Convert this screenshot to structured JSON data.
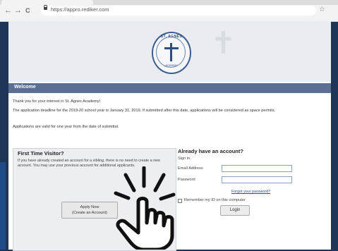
{
  "browser": {
    "url": "https://appro.rediker.com",
    "back_icon": "←",
    "forward_icon": "→",
    "reload_icon": "C",
    "star_icon": "☆"
  },
  "seal": {
    "top_text": "ST. AGNES",
    "bottom_text": "ACADEMY"
  },
  "welcome": {
    "title": "Welcome",
    "line1": "Thank you for your interest in St. Agnes Academy!",
    "line2": "The application deadline for the 2019-20 school year is January 31, 2019. If submitted after this date, applications will be considered as space permits.",
    "line3": "Applications are valid for one year from the date of submittal."
  },
  "first_time": {
    "title": "First Time Visitor?",
    "description": "If you have already created an account for a sibling, there is no need to create a new account. You may use your previous account for additional applicants.",
    "apply_line1": "Apply Now",
    "apply_line2": "(Create an Account)"
  },
  "login": {
    "title": "Already have an account?",
    "signin_label": "Sign in.",
    "email_label": "Email Address",
    "password_label": "Password",
    "forgot_label": "Forgot your password?",
    "remember_label": "Remember my ID on this computer",
    "login_button": "Login"
  }
}
